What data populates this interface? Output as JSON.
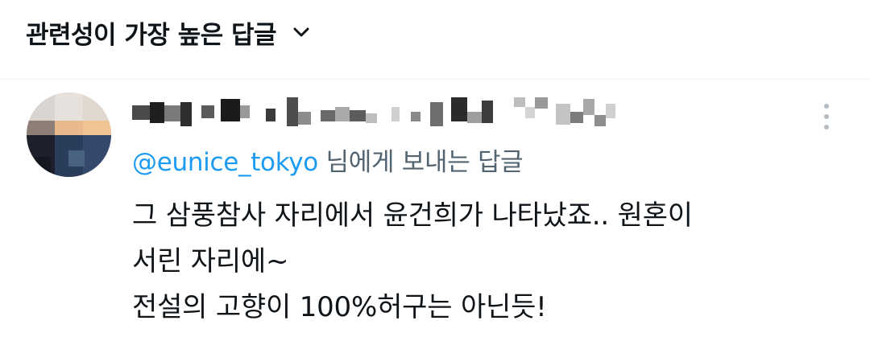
{
  "header": {
    "sort_label": "관련성이 가장 높은 답글",
    "sort_icon": "chevron-down-icon"
  },
  "reply": {
    "author_display_name": "",
    "replying_to": {
      "mention": "@eunice_tokyo",
      "suffix": " 님에게 보내는 답글"
    },
    "text_lines": [
      "그 삼풍참사 자리에서 윤건희가 나타났죠.. 원혼이",
      "서린 자리에~",
      "전설의 고향이 100%허구는 아닌듯!"
    ],
    "more_icon": "more-vertical-icon"
  },
  "colors": {
    "text_primary": "#0f1419",
    "text_secondary": "#536471",
    "accent": "#1d9bf0",
    "divider": "#eff3f4"
  }
}
